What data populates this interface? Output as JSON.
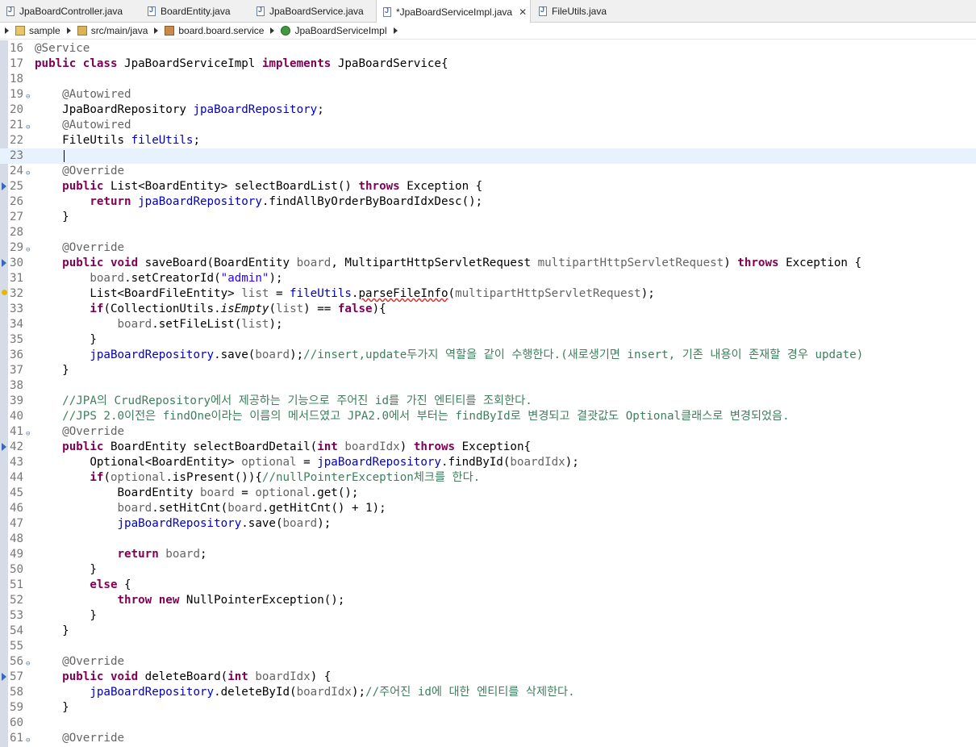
{
  "tabs": [
    {
      "label": "JpaBoardController.java",
      "active": false
    },
    {
      "label": "BoardEntity.java",
      "active": false
    },
    {
      "label": "JpaBoardService.java",
      "active": false
    },
    {
      "label": "*JpaBoardServiceImpl.java",
      "active": true,
      "close": "✕"
    },
    {
      "label": "FileUtils.java",
      "active": false
    }
  ],
  "breadcrumb": {
    "project": "sample",
    "source_folder": "src/main/java",
    "package": "board.board.service",
    "class": "JpaBoardServiceImpl"
  },
  "editor": {
    "current_line": 23,
    "lines": [
      {
        "n": "16",
        "tokens": [
          [
            "ann",
            "@Service"
          ]
        ]
      },
      {
        "n": "17",
        "tokens": [
          [
            "kw",
            "public"
          ],
          [
            "",
            " "
          ],
          [
            "kw",
            "class"
          ],
          [
            "",
            " JpaBoardServiceImpl "
          ],
          [
            "kw",
            "implements"
          ],
          [
            "",
            " JpaBoardService{"
          ]
        ]
      },
      {
        "n": "18",
        "tokens": []
      },
      {
        "n": "19",
        "fold": true,
        "tokens": [
          [
            "",
            "    "
          ],
          [
            "ann",
            "@Autowired"
          ]
        ]
      },
      {
        "n": "20",
        "tokens": [
          [
            "",
            "    JpaBoardRepository "
          ],
          [
            "fld",
            "jpaBoardRepository"
          ],
          [
            "",
            ";"
          ]
        ]
      },
      {
        "n": "21",
        "fold": true,
        "tokens": [
          [
            "",
            "    "
          ],
          [
            "ann",
            "@Autowired"
          ]
        ]
      },
      {
        "n": "22",
        "tokens": [
          [
            "",
            "    FileUtils "
          ],
          [
            "fld",
            "fileUtils"
          ],
          [
            "",
            ";"
          ]
        ]
      },
      {
        "n": "23",
        "tokens": []
      },
      {
        "n": "24",
        "fold": true,
        "tokens": [
          [
            "",
            "    "
          ],
          [
            "ann",
            "@Override"
          ]
        ]
      },
      {
        "n": "25",
        "marker": "override",
        "tokens": [
          [
            "",
            "    "
          ],
          [
            "kw",
            "public"
          ],
          [
            "",
            " List<BoardEntity> selectBoardList() "
          ],
          [
            "kw",
            "throws"
          ],
          [
            "",
            " Exception {"
          ]
        ]
      },
      {
        "n": "26",
        "tokens": [
          [
            "",
            "        "
          ],
          [
            "kw",
            "return"
          ],
          [
            "",
            " "
          ],
          [
            "fld",
            "jpaBoardRepository"
          ],
          [
            "",
            ".findAllByOrderByBoardIdxDesc();"
          ]
        ]
      },
      {
        "n": "27",
        "tokens": [
          [
            "",
            "    }"
          ]
        ]
      },
      {
        "n": "28",
        "tokens": []
      },
      {
        "n": "29",
        "fold": true,
        "tokens": [
          [
            "",
            "    "
          ],
          [
            "ann",
            "@Override"
          ]
        ]
      },
      {
        "n": "30",
        "marker": "override",
        "tokens": [
          [
            "",
            "    "
          ],
          [
            "kw",
            "public"
          ],
          [
            "",
            " "
          ],
          [
            "kw",
            "void"
          ],
          [
            "",
            " saveBoard(BoardEntity "
          ],
          [
            "ann",
            "board"
          ],
          [
            "",
            ", MultipartHttpServletRequest "
          ],
          [
            "ann",
            "multipartHttpServletRequest"
          ],
          [
            "",
            ") "
          ],
          [
            "kw",
            "throws"
          ],
          [
            "",
            " Exception {"
          ]
        ]
      },
      {
        "n": "31",
        "tokens": [
          [
            "",
            "        "
          ],
          [
            "ann",
            "board"
          ],
          [
            "",
            ".setCreatorId("
          ],
          [
            "str",
            "\"admin\""
          ],
          [
            "",
            ");"
          ]
        ]
      },
      {
        "n": "32",
        "marker": "warning",
        "tokens": [
          [
            "",
            "        List<BoardFileEntity> "
          ],
          [
            "ann",
            "list"
          ],
          [
            "",
            " = "
          ],
          [
            "fld",
            "fileUtils"
          ],
          [
            "",
            "."
          ],
          [
            "squig",
            "parseFileInfo"
          ],
          [
            "",
            "("
          ],
          [
            "ann",
            "multipartHttpServletRequest"
          ],
          [
            "",
            ");"
          ]
        ]
      },
      {
        "n": "33",
        "tokens": [
          [
            "",
            "        "
          ],
          [
            "kw",
            "if"
          ],
          [
            "",
            "(CollectionUtils."
          ],
          [
            "it",
            "isEmpty"
          ],
          [
            "",
            "("
          ],
          [
            "ann",
            "list"
          ],
          [
            "",
            ") == "
          ],
          [
            "kw",
            "false"
          ],
          [
            "",
            "){"
          ]
        ]
      },
      {
        "n": "34",
        "tokens": [
          [
            "",
            "            "
          ],
          [
            "ann",
            "board"
          ],
          [
            "",
            ".setFileList("
          ],
          [
            "ann",
            "list"
          ],
          [
            "",
            ");"
          ]
        ]
      },
      {
        "n": "35",
        "tokens": [
          [
            "",
            "        }"
          ]
        ]
      },
      {
        "n": "36",
        "tokens": [
          [
            "",
            "        "
          ],
          [
            "fld",
            "jpaBoardRepository"
          ],
          [
            "",
            ".save("
          ],
          [
            "ann",
            "board"
          ],
          [
            "",
            ");"
          ],
          [
            "cmt",
            "//insert,update두가지 역할을 같이 수행한다.(새로생기면 insert, 기존 내용이 존재할 경우 update)"
          ]
        ]
      },
      {
        "n": "37",
        "tokens": [
          [
            "",
            "    }"
          ]
        ]
      },
      {
        "n": "38",
        "tokens": []
      },
      {
        "n": "39",
        "tokens": [
          [
            "",
            "    "
          ],
          [
            "cmt",
            "//JPA의 CrudRepository에서 제공하는 기능으로 주어진 id를 가진 엔티티를 조회한다."
          ]
        ]
      },
      {
        "n": "40",
        "tokens": [
          [
            "",
            "    "
          ],
          [
            "cmt",
            "//JPS 2.0이전은 findOne이라는 이름의 메서드였고 JPA2.0에서 부터는 findById로 변경되고 결괏값도 Optional클래스로 변경되었음."
          ]
        ]
      },
      {
        "n": "41",
        "fold": true,
        "tokens": [
          [
            "",
            "    "
          ],
          [
            "ann",
            "@Override"
          ]
        ]
      },
      {
        "n": "42",
        "marker": "override",
        "tokens": [
          [
            "",
            "    "
          ],
          [
            "kw",
            "public"
          ],
          [
            "",
            " BoardEntity selectBoardDetail("
          ],
          [
            "kw",
            "int"
          ],
          [
            "",
            " "
          ],
          [
            "ann",
            "boardIdx"
          ],
          [
            "",
            ") "
          ],
          [
            "kw",
            "throws"
          ],
          [
            "",
            " Exception{"
          ]
        ]
      },
      {
        "n": "43",
        "tokens": [
          [
            "",
            "        Optional<BoardEntity> "
          ],
          [
            "ann",
            "optional"
          ],
          [
            "",
            " = "
          ],
          [
            "fld",
            "jpaBoardRepository"
          ],
          [
            "",
            ".findById("
          ],
          [
            "ann",
            "boardIdx"
          ],
          [
            "",
            ");"
          ]
        ]
      },
      {
        "n": "44",
        "tokens": [
          [
            "",
            "        "
          ],
          [
            "kw",
            "if"
          ],
          [
            "",
            "("
          ],
          [
            "ann",
            "optional"
          ],
          [
            "",
            ".isPresent()){"
          ],
          [
            "cmt",
            "//nullPointerException체크를 한다."
          ]
        ]
      },
      {
        "n": "45",
        "tokens": [
          [
            "",
            "            BoardEntity "
          ],
          [
            "ann",
            "board"
          ],
          [
            "",
            " = "
          ],
          [
            "ann",
            "optional"
          ],
          [
            "",
            ".get();"
          ]
        ]
      },
      {
        "n": "46",
        "tokens": [
          [
            "",
            "            "
          ],
          [
            "ann",
            "board"
          ],
          [
            "",
            ".setHitCnt("
          ],
          [
            "ann",
            "board"
          ],
          [
            "",
            ".getHitCnt() + 1);"
          ]
        ]
      },
      {
        "n": "47",
        "tokens": [
          [
            "",
            "            "
          ],
          [
            "fld",
            "jpaBoardRepository"
          ],
          [
            "",
            ".save("
          ],
          [
            "ann",
            "board"
          ],
          [
            "",
            ");"
          ]
        ]
      },
      {
        "n": "48",
        "tokens": []
      },
      {
        "n": "49",
        "tokens": [
          [
            "",
            "            "
          ],
          [
            "kw",
            "return"
          ],
          [
            "",
            " "
          ],
          [
            "ann",
            "board"
          ],
          [
            "",
            ";"
          ]
        ]
      },
      {
        "n": "50",
        "tokens": [
          [
            "",
            "        }"
          ]
        ]
      },
      {
        "n": "51",
        "tokens": [
          [
            "",
            "        "
          ],
          [
            "kw",
            "else"
          ],
          [
            "",
            " {"
          ]
        ]
      },
      {
        "n": "52",
        "tokens": [
          [
            "",
            "            "
          ],
          [
            "kw",
            "throw"
          ],
          [
            "",
            " "
          ],
          [
            "kw",
            "new"
          ],
          [
            "",
            " NullPointerException();"
          ]
        ]
      },
      {
        "n": "53",
        "tokens": [
          [
            "",
            "        }"
          ]
        ]
      },
      {
        "n": "54",
        "tokens": [
          [
            "",
            "    }"
          ]
        ]
      },
      {
        "n": "55",
        "tokens": []
      },
      {
        "n": "56",
        "fold": true,
        "tokens": [
          [
            "",
            "    "
          ],
          [
            "ann",
            "@Override"
          ]
        ]
      },
      {
        "n": "57",
        "marker": "override",
        "tokens": [
          [
            "",
            "    "
          ],
          [
            "kw",
            "public"
          ],
          [
            "",
            " "
          ],
          [
            "kw",
            "void"
          ],
          [
            "",
            " deleteBoard("
          ],
          [
            "kw",
            "int"
          ],
          [
            "",
            " "
          ],
          [
            "ann",
            "boardIdx"
          ],
          [
            "",
            ") {"
          ]
        ]
      },
      {
        "n": "58",
        "tokens": [
          [
            "",
            "        "
          ],
          [
            "fld",
            "jpaBoardRepository"
          ],
          [
            "",
            ".deleteById("
          ],
          [
            "ann",
            "boardIdx"
          ],
          [
            "",
            ");"
          ],
          [
            "cmt",
            "//주어진 id에 대한 엔티티를 삭제한다."
          ]
        ]
      },
      {
        "n": "59",
        "tokens": [
          [
            "",
            "    }"
          ]
        ]
      },
      {
        "n": "60",
        "tokens": []
      },
      {
        "n": "61",
        "fold": true,
        "tokens": [
          [
            "",
            "    "
          ],
          [
            "ann",
            "@Override"
          ]
        ]
      }
    ]
  }
}
